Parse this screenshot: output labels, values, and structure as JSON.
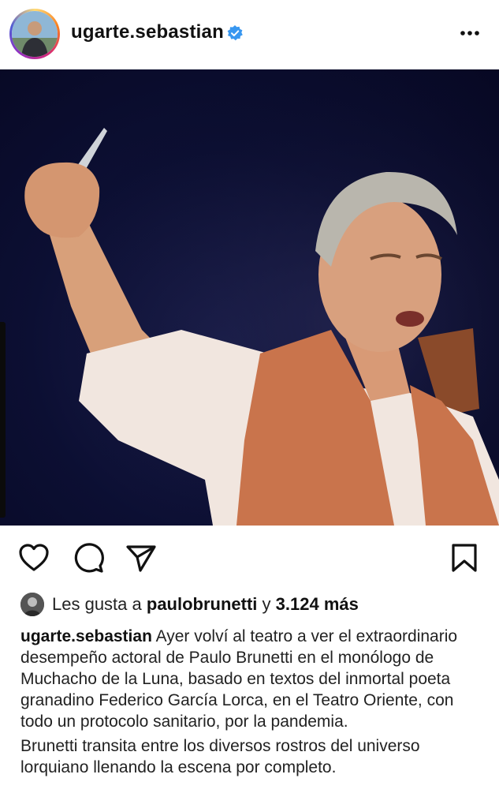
{
  "header": {
    "username": "ugarte.sebastian",
    "verified": true,
    "avatar_icon": "profile-photo",
    "more_icon": "more-horizontal-icon"
  },
  "post": {
    "image_subject": "actor on stage raising a fist holding a knife",
    "background_color": "#0c0f33"
  },
  "actions": {
    "like_icon": "heart-icon",
    "comment_icon": "comment-icon",
    "share_icon": "send-icon",
    "save_icon": "bookmark-icon"
  },
  "likes": {
    "prefix": "Les gusta a",
    "user": "paulobrunetti",
    "connector": "y",
    "count": "3.124 más"
  },
  "caption": {
    "username": "ugarte.sebastian",
    "text": "Ayer volví al teatro a ver el extraordinario desempeño actoral de Paulo Brunetti en el monólogo de Muchacho de la Luna, basado en textos del inmortal poeta granadino Federico García Lorca, en el Teatro Oriente, con todo un protocolo sanitario, por la pandemia.",
    "text2": "Brunetti transita entre los diversos rostros del universo lorquiano llenando la escena por completo."
  },
  "colors": {
    "verified_blue": "#3897f0",
    "text_primary": "#111111"
  }
}
